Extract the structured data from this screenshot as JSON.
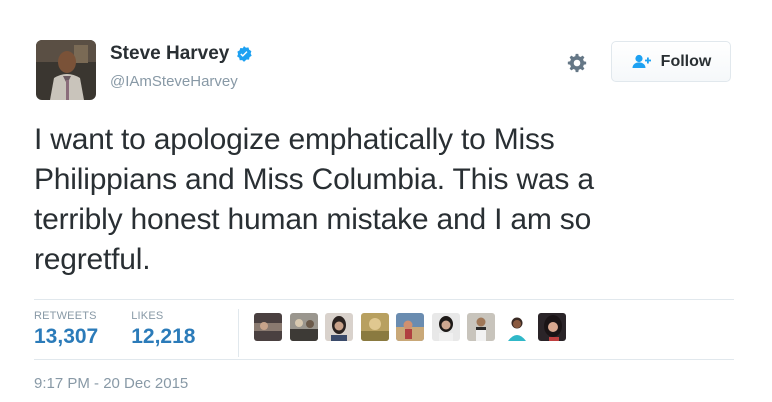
{
  "user": {
    "name": "Steve Harvey",
    "handle": "@IAmSteveHarvey",
    "verified": true
  },
  "actions": {
    "follow_label": "Follow"
  },
  "tweet": {
    "lines": [
      "I want to apologize emphatically to Miss",
      "Philippians and Miss Columbia. This was a",
      "terribly honest human mistake and I am so",
      "regretful."
    ]
  },
  "stats": {
    "retweets_label": "RETWEETS",
    "retweets_count": "13,307",
    "likes_label": "LIKES",
    "likes_count": "12,218"
  },
  "timestamp": "9:17 PM - 20 Dec 2015",
  "colors": {
    "text": "#292f33",
    "muted": "#8899a6",
    "link_blue": "#2b7bb9",
    "verified_blue": "#1da1f2",
    "border": "#e1e8ed"
  },
  "icons": {
    "verified": "verified-badge-icon",
    "gear": "gear-icon",
    "follow": "add-user-icon"
  }
}
